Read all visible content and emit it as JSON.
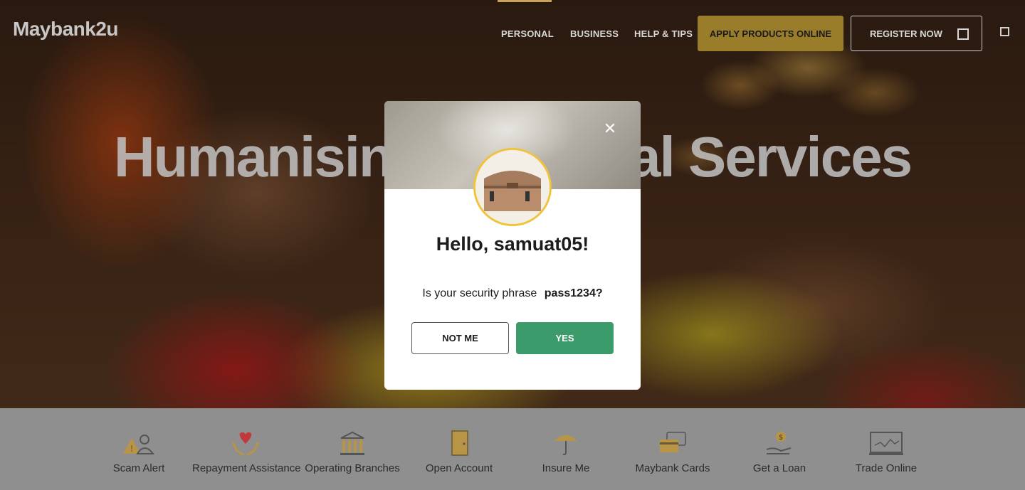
{
  "header": {
    "logo": "Maybank2u",
    "nav": [
      "PERSONAL",
      "BUSINESS",
      "HELP & TIPS"
    ],
    "apply_label": "APPLY PRODUCTS ONLINE",
    "register_label": "REGISTER NOW"
  },
  "hero": {
    "headline": "Humanising Financial Services"
  },
  "modal": {
    "greeting": "Hello, samuat05!",
    "question": "Is your security phrase",
    "phrase": "pass1234?",
    "not_me_label": "NOT ME",
    "yes_label": "YES",
    "close_icon": "close-icon",
    "image": "treasure-box-image"
  },
  "quick_links": [
    {
      "label": "Scam Alert",
      "icon": "scam-alert-icon"
    },
    {
      "label": "Repayment Assistance",
      "icon": "repayment-heart-icon"
    },
    {
      "label": "Operating Branches",
      "icon": "bank-building-icon"
    },
    {
      "label": "Open Account",
      "icon": "door-icon"
    },
    {
      "label": "Insure Me",
      "icon": "umbrella-icon"
    },
    {
      "label": "Maybank Cards",
      "icon": "cards-icon"
    },
    {
      "label": "Get a Loan",
      "icon": "loan-hand-icon"
    },
    {
      "label": "Trade Online",
      "icon": "trade-chart-icon"
    }
  ],
  "colors": {
    "accent_gold": "#9a7d2a",
    "yes_green": "#3b9b6b",
    "avatar_ring": "#f0c33c"
  }
}
